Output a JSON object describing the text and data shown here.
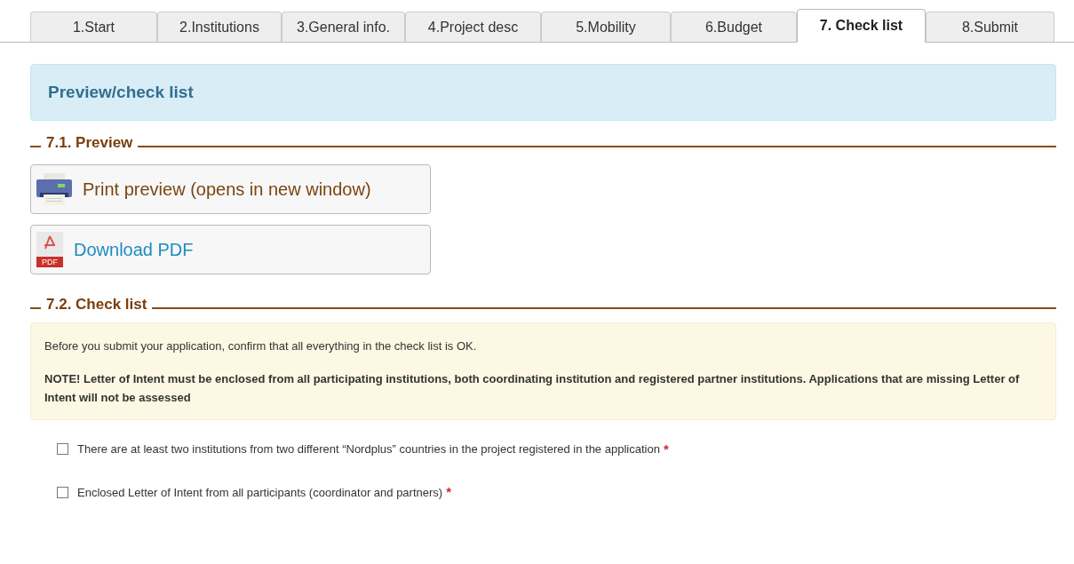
{
  "tabs": [
    {
      "label": "1.Start",
      "selected": false
    },
    {
      "label": "2.Institutions",
      "selected": false
    },
    {
      "label": "3.General info.",
      "selected": false
    },
    {
      "label": "4.Project desc",
      "selected": false
    },
    {
      "label": "5.Mobility",
      "selected": false
    },
    {
      "label": "6.Budget",
      "selected": false
    },
    {
      "label": "7. Check list",
      "selected": true
    },
    {
      "label": "8.Submit",
      "selected": false
    }
  ],
  "panel_title": "Preview/check list",
  "preview": {
    "heading": "7.1. Preview",
    "buttons": [
      {
        "kind": "print",
        "label": "Print preview (opens in new window)"
      },
      {
        "kind": "pdf",
        "label": "Download PDF",
        "icon_text": "PDF"
      }
    ]
  },
  "check_list": {
    "heading": "7.2. Check list",
    "intro": "Before you submit your application, confirm that all everything in the check list is OK.",
    "note": "NOTE! Letter of Intent must be enclosed from all participating institutions, both coordinating institution and registered partner institutions. Applications that are missing Letter of Intent will not be assessed",
    "items": [
      {
        "label": "There are at least two institutions from two different “Nordplus” countries in the project registered in the application",
        "checked": false,
        "required_mark": "*"
      },
      {
        "label": "Enclosed Letter of Intent from all participants (coordinator and partners)",
        "checked": false,
        "required_mark": "*"
      }
    ]
  }
}
